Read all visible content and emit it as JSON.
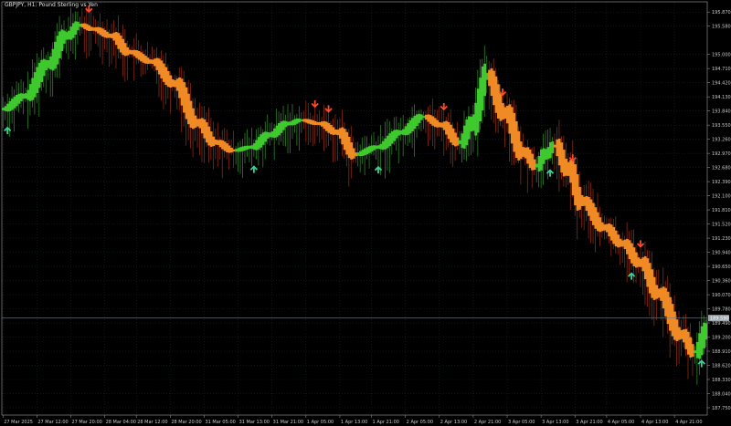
{
  "window": {
    "symbol_title": "GBPJPY, H1: Pound Sterling vs Yen"
  },
  "colors": {
    "background": "#000000",
    "grid": "#1c2b33",
    "axis": "#8a8a8a",
    "text": "#c8c8c8",
    "bull_heiken": "#3fc92f",
    "bear_heiken": "#f08a24",
    "bull_wick": "#2f7f25",
    "bear_wick": "#8a2a12",
    "buy_arrow": "#38d39b",
    "sell_arrow": "#ff4a2a",
    "price_line": "#6f7f86",
    "price_tag_bg": "#9aa7ad",
    "price_tag_text": "#ffffff"
  },
  "chart_data": {
    "type": "candlestick",
    "price_axis_labels": [
      "195.870",
      "195.580",
      "195.000",
      "194.710",
      "194.420",
      "194.130",
      "193.840",
      "193.550",
      "193.260",
      "192.970",
      "192.680",
      "192.390",
      "192.100",
      "191.810",
      "191.520",
      "191.230",
      "190.940",
      "190.650",
      "190.360",
      "190.070",
      "189.780",
      "189.490",
      "189.200",
      "188.910",
      "188.620",
      "188.330",
      "188.040",
      "187.750"
    ],
    "price_range": [
      187.6,
      196.08
    ],
    "time_axis_labels": [
      "27 Mar 2025",
      "27 Mar 12:00",
      "27 Mar 20:00",
      "28 Mar 04:00",
      "28 Mar 12:00",
      "28 Mar 20:00",
      "31 Mar 05:00",
      "31 Mar 13:00",
      "31 Mar 21:00",
      "1 Apr 05:00",
      "1 Apr 13:00",
      "1 Apr 21:00",
      "2 Apr 05:00",
      "2 Apr 13:00",
      "2 Apr 21:00",
      "3 Apr 05:00",
      "3 Apr 13:00",
      "3 Apr 21:00",
      "4 Apr 05:00",
      "4 Apr 13:00",
      "4 Apr 21:00"
    ],
    "current_price": "189.590",
    "current_price_value": 189.59,
    "path_keypoints": [
      [
        0,
        193.88
      ],
      [
        10,
        194.15
      ],
      [
        20,
        194.8
      ],
      [
        28,
        195.38
      ],
      [
        34,
        195.6
      ],
      [
        40,
        195.52
      ],
      [
        48,
        195.38
      ],
      [
        56,
        195.05
      ],
      [
        66,
        194.85
      ],
      [
        76,
        194.4
      ],
      [
        86,
        193.6
      ],
      [
        94,
        193.2
      ],
      [
        102,
        193.03
      ],
      [
        110,
        193.1
      ],
      [
        118,
        193.35
      ],
      [
        126,
        193.58
      ],
      [
        132,
        193.65
      ],
      [
        140,
        193.58
      ],
      [
        148,
        193.4
      ],
      [
        156,
        192.95
      ],
      [
        166,
        193.1
      ],
      [
        176,
        193.4
      ],
      [
        186,
        193.72
      ],
      [
        194,
        193.55
      ],
      [
        202,
        193.2
      ],
      [
        208,
        193.6
      ],
      [
        214,
        194.55
      ],
      [
        222,
        193.8
      ],
      [
        230,
        193.0
      ],
      [
        236,
        192.72
      ],
      [
        240,
        192.95
      ],
      [
        244,
        193.12
      ],
      [
        250,
        192.65
      ],
      [
        256,
        192.0
      ],
      [
        266,
        191.45
      ],
      [
        274,
        191.12
      ],
      [
        282,
        190.72
      ],
      [
        290,
        190.1
      ],
      [
        300,
        189.25
      ],
      [
        306,
        188.9
      ],
      [
        312,
        189.35
      ]
    ],
    "bar_count": 312,
    "buy_signal_bars": [
      2,
      111,
      166,
      242,
      278,
      309
    ],
    "sell_signal_bars": [
      38,
      138,
      144,
      195,
      221,
      252,
      282
    ]
  }
}
